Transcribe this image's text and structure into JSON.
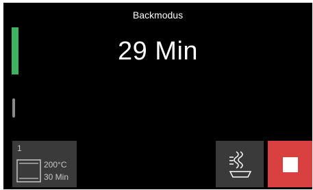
{
  "header": {
    "title": "Backmodus"
  },
  "timer": {
    "value": "29 Min"
  },
  "program": {
    "number": "1",
    "temperature": "200°C",
    "duration": "30 Min"
  },
  "icons": {
    "oven": "oven-icon",
    "steam": "steam-bake-icon",
    "stop": "stop-icon"
  },
  "colors": {
    "active_indicator": "#3db360",
    "stop_button": "#d94040",
    "tile_background": "#3a3a3a"
  }
}
